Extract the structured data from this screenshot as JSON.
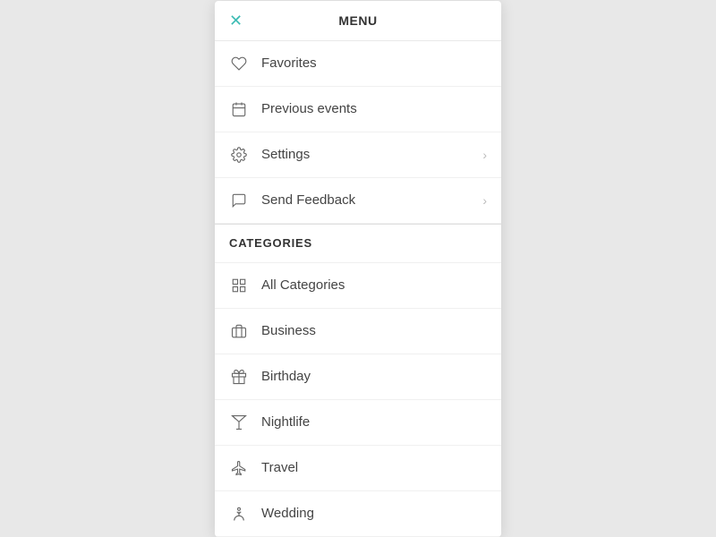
{
  "header": {
    "title": "MENU",
    "close_label": "✕"
  },
  "menu_items": [
    {
      "id": "favorites",
      "label": "Favorites",
      "icon": "heart",
      "has_chevron": false
    },
    {
      "id": "previous-events",
      "label": "Previous events",
      "icon": "calendar",
      "has_chevron": false
    },
    {
      "id": "settings",
      "label": "Settings",
      "icon": "gear",
      "has_chevron": true
    },
    {
      "id": "send-feedback",
      "label": "Send Feedback",
      "icon": "feedback",
      "has_chevron": true
    }
  ],
  "categories_header": {
    "title": "CATEGORIES"
  },
  "category_items": [
    {
      "id": "all-categories",
      "label": "All Categories",
      "icon": "grid"
    },
    {
      "id": "business",
      "label": "Business",
      "icon": "briefcase"
    },
    {
      "id": "birthday",
      "label": "Birthday",
      "icon": "gift"
    },
    {
      "id": "nightlife",
      "label": "Nightlife",
      "icon": "cocktail"
    },
    {
      "id": "travel",
      "label": "Travel",
      "icon": "plane"
    },
    {
      "id": "wedding",
      "label": "Wedding",
      "icon": "wedding"
    }
  ]
}
